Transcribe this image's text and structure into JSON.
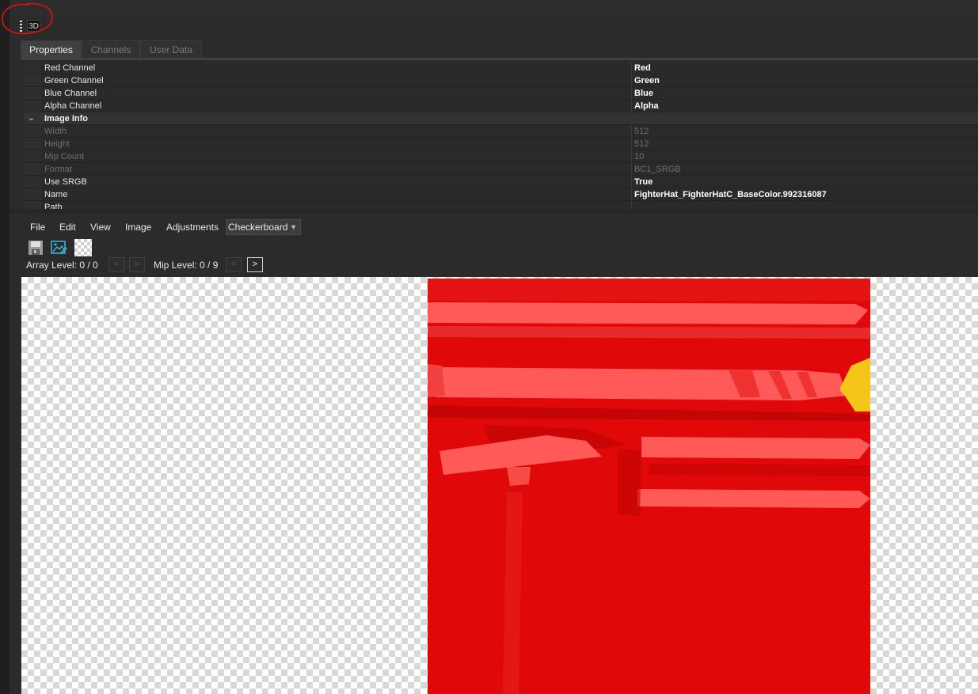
{
  "header": {
    "badge": "3D"
  },
  "tabs": [
    {
      "label": "Properties",
      "active": true
    },
    {
      "label": "Channels",
      "active": false
    },
    {
      "label": "User Data",
      "active": false
    }
  ],
  "properties": {
    "rows": [
      {
        "name": "Red Channel",
        "value": "Red"
      },
      {
        "name": "Green Channel",
        "value": "Green"
      },
      {
        "name": "Blue Channel",
        "value": "Blue"
      },
      {
        "name": "Alpha Channel",
        "value": "Alpha"
      }
    ],
    "category": "Image Info",
    "info_rows": [
      {
        "name": "Width",
        "value": "512",
        "readonly": true
      },
      {
        "name": "Height",
        "value": "512",
        "readonly": true
      },
      {
        "name": "Mip Count",
        "value": "10",
        "readonly": true
      },
      {
        "name": "Format",
        "value": "BC1_SRGB",
        "readonly": true
      },
      {
        "name": "Use SRGB",
        "value": "True",
        "readonly": false
      },
      {
        "name": "Name",
        "value": "FighterHat_FighterHatC_BaseColor.992316087",
        "readonly": false
      },
      {
        "name": "Path",
        "value": "",
        "readonly": false
      }
    ]
  },
  "menu": {
    "file": "File",
    "edit": "Edit",
    "view": "View",
    "image": "Image",
    "adjustments": "Adjustments",
    "background_select": "Checkerboard"
  },
  "levels": {
    "array_label": "Array Level: 0 / 0",
    "mip_label": "Mip Level: 0 / 9",
    "prev": "<",
    "next": ">"
  },
  "colors": {
    "texture_red": "#e00808",
    "texture_highlight": "#ff5a58",
    "star_yellow": "#f5c518",
    "annotation_circle": "#e01010"
  },
  "icons": [
    "save-icon",
    "export-image-icon",
    "checkerboard-icon",
    "chevron-down-icon",
    "drag-handle-icon"
  ]
}
